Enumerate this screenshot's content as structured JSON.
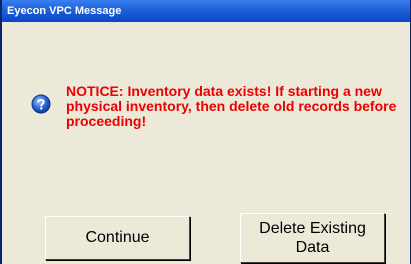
{
  "window": {
    "title": "Eyecon VPC Message"
  },
  "message": {
    "icon": "question-icon",
    "text": "NOTICE: Inventory data exists! If starting a new physical inventory, then delete old records before proceeding!",
    "color": "#ee0000"
  },
  "buttons": {
    "continue_label": "Continue",
    "delete_label": "Delete Existing Data"
  }
}
